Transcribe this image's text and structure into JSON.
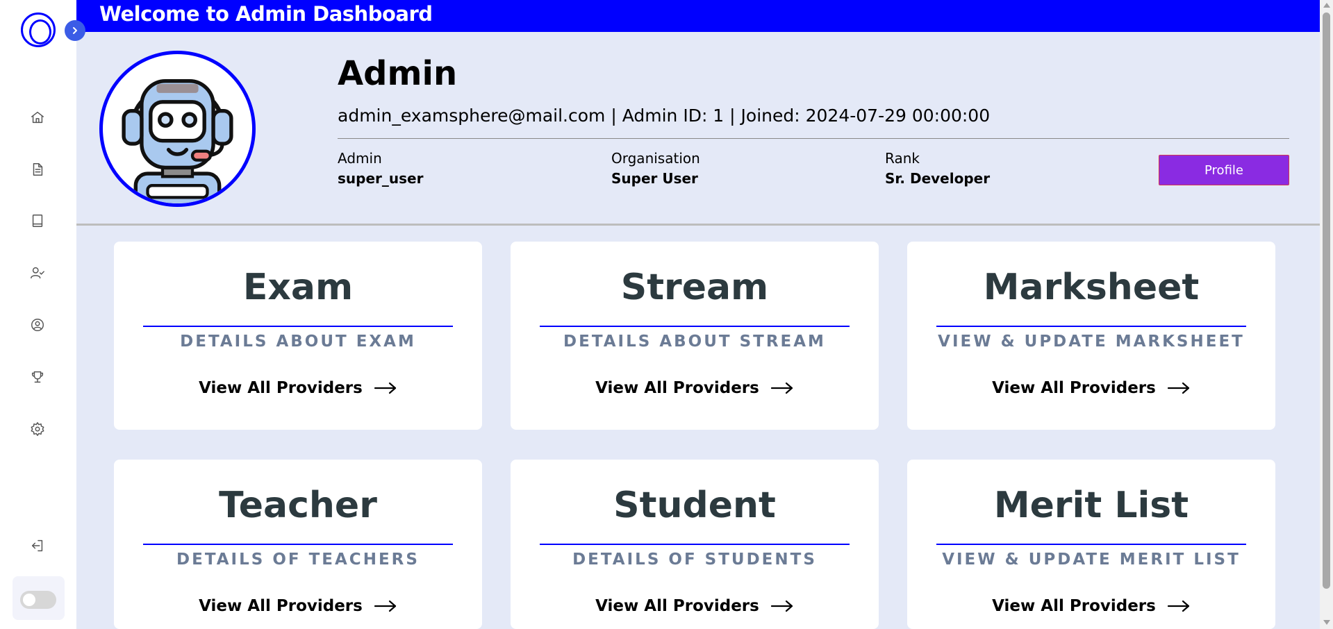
{
  "header": {
    "title": "Welcome to Admin Dashboard"
  },
  "sidebar": {
    "icons": [
      "logo-icon",
      "chevron-right-icon",
      "home-icon",
      "document-icon",
      "book-icon",
      "user-check-icon",
      "user-circle-icon",
      "trophy-icon",
      "settings-icon",
      "logout-icon"
    ],
    "dark_mode_toggle": "off"
  },
  "profile": {
    "name": "Admin",
    "meta": "admin_examsphere@mail.com | Admin ID: 1 | Joined: 2024-07-29 00:00:00",
    "fields": [
      {
        "label": "Admin",
        "value": "super_user"
      },
      {
        "label": "Organisation",
        "value": "Super User"
      },
      {
        "label": "Rank",
        "value": "Sr. Developer"
      }
    ],
    "button_label": "Profile"
  },
  "cards": [
    {
      "title": "Exam",
      "subtitle": "DETAILS ABOUT EXAM",
      "link": "View All Providers"
    },
    {
      "title": "Stream",
      "subtitle": "DETAILS ABOUT STREAM",
      "link": "View All Providers"
    },
    {
      "title": "Marksheet",
      "subtitle": "VIEW & UPDATE MARKSHEET",
      "link": "View All Providers"
    },
    {
      "title": "Teacher",
      "subtitle": "DETAILS OF TEACHERS",
      "link": "View All Providers"
    },
    {
      "title": "Student",
      "subtitle": "DETAILS OF STUDENTS",
      "link": "View All Providers"
    },
    {
      "title": "Merit List",
      "subtitle": "VIEW & UPDATE MERIT LIST",
      "link": "View All Providers"
    }
  ],
  "colors": {
    "header_bg": "#0000ff",
    "page_bg": "#e4e9f7",
    "profile_button": "#8a2be2",
    "card_title": "#2c3a3f",
    "card_subtitle": "#6b7b95"
  }
}
